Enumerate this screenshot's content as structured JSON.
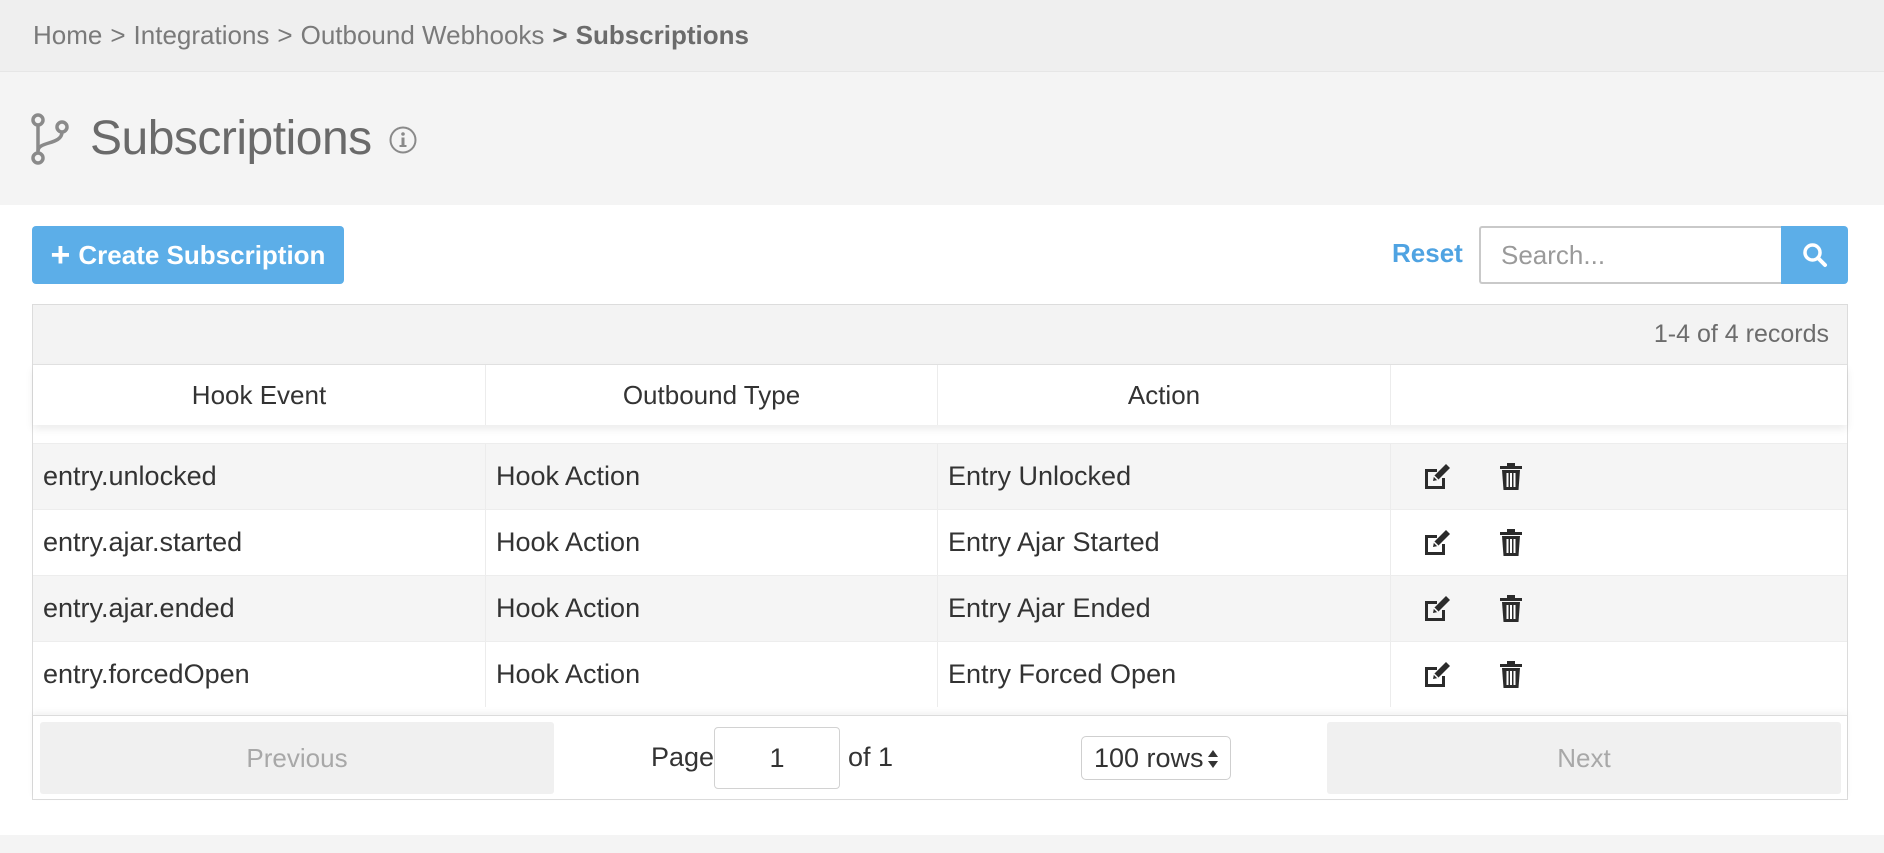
{
  "breadcrumb": {
    "items": [
      {
        "label": "Home"
      },
      {
        "label": "Integrations"
      },
      {
        "label": "Outbound Webhooks"
      },
      {
        "label": "Subscriptions"
      }
    ],
    "separator": ">"
  },
  "header": {
    "title": "Subscriptions",
    "icon": "branch-icon",
    "info_icon": "info-icon"
  },
  "toolbar": {
    "create_label": "Create Subscription",
    "reset_label": "Reset",
    "search_placeholder": "Search...",
    "search_value": ""
  },
  "table": {
    "records_text": "1-4 of 4 records",
    "columns": [
      "Hook Event",
      "Outbound Type",
      "Action",
      ""
    ],
    "rows": [
      {
        "hook_event": "entry.unlocked",
        "outbound_type": "Hook Action",
        "action": "Entry Unlocked"
      },
      {
        "hook_event": "entry.ajar.started",
        "outbound_type": "Hook Action",
        "action": "Entry Ajar Started"
      },
      {
        "hook_event": "entry.ajar.ended",
        "outbound_type": "Hook Action",
        "action": "Entry Ajar Ended"
      },
      {
        "hook_event": "entry.forcedOpen",
        "outbound_type": "Hook Action",
        "action": "Entry Forced Open"
      }
    ]
  },
  "pagination": {
    "previous_label": "Previous",
    "next_label": "Next",
    "page_label": "Page",
    "page_value": "1",
    "of_label": "of 1",
    "rows_label": "100 rows"
  },
  "colors": {
    "accent": "#5caee8",
    "link": "#4fa3e2"
  }
}
